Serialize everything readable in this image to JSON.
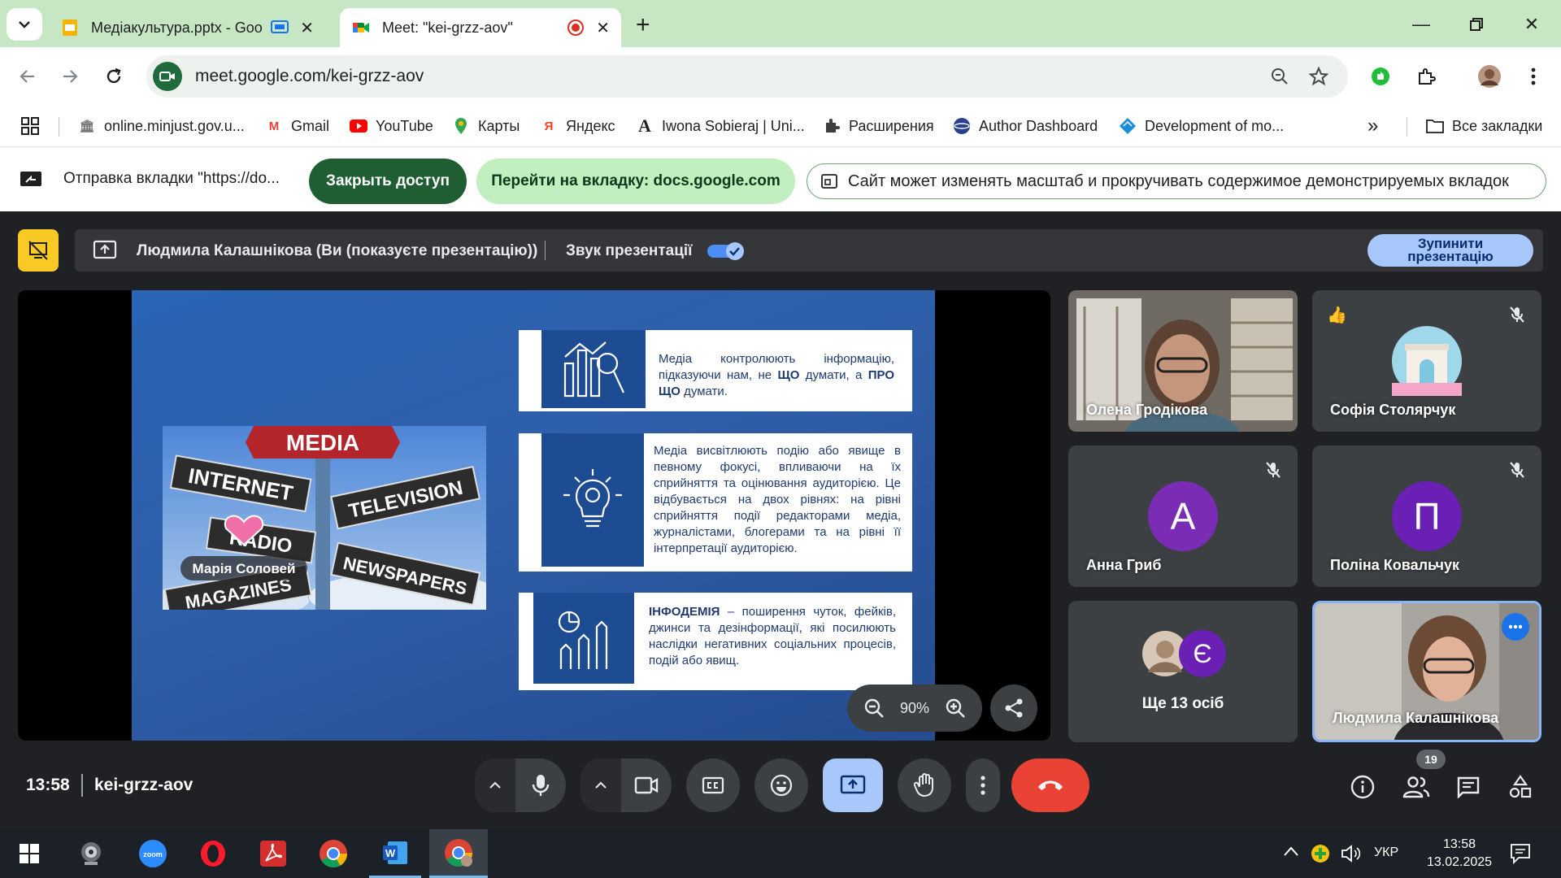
{
  "browser": {
    "tabs": [
      {
        "title": "Медіакультура.pptx - Goog",
        "active": false
      },
      {
        "title": "Meet: \"kei-grzz-aov\"",
        "active": true
      }
    ],
    "url": "meet.google.com/kei-grzz-aov",
    "bookmarks": [
      {
        "label": "online.minjust.gov.u...",
        "icon": "building-icon"
      },
      {
        "label": "Gmail",
        "icon": "gmail-icon"
      },
      {
        "label": "YouTube",
        "icon": "youtube-icon"
      },
      {
        "label": "Карты",
        "icon": "maps-pin-icon"
      },
      {
        "label": "Яндекс",
        "icon": "yandex-icon"
      },
      {
        "label": "Iwona Sobieraj | Uni...",
        "icon": "letter-a-icon"
      },
      {
        "label": "Расширения",
        "icon": "puzzle-icon"
      },
      {
        "label": "Author Dashboard",
        "icon": "globe-icon"
      },
      {
        "label": "Development of mo...",
        "icon": "diamond-icon"
      }
    ],
    "all_bookmarks_label": "Все закладки"
  },
  "share_bar": {
    "sharing_text": "Отправка вкладки \"https://do...",
    "stop_button": "Закрыть доступ",
    "switch_button": "Перейти на вкладку: docs.google.com",
    "zoom_notice": "Сайт может изменять масштаб и прокручивать содержимое демонстрируемых вкладок"
  },
  "meet": {
    "presenting_label": "Людмила Калашнікова (Ви (показуєте презентацію))",
    "audio_label": "Звук презентації",
    "audio_on": true,
    "stop_presenting": [
      "Зупинити",
      "презентацію"
    ],
    "zoom_level": "90%",
    "clock": "13:58",
    "meeting_code": "kei-grzz-aov",
    "people_count": "19"
  },
  "slide": {
    "photo_signs": [
      "MEDIA",
      "INTERNET",
      "TELEVISION",
      "RADIO",
      "NEWSPAPERS",
      "MAGAZINES"
    ],
    "photo_caption": "Марія Соловей",
    "cards": [
      {
        "parts": [
          {
            "t": "Медіа контролюють інформацію, підказуючи нам, не "
          },
          {
            "t": "ЩО",
            "b": true
          },
          {
            "t": " думати, а "
          },
          {
            "t": "ПРО ЩО",
            "b": true
          },
          {
            "t": " думати."
          }
        ]
      },
      {
        "parts": [
          {
            "t": "Медіа висвітлюють подію або явище в певному фокусі, впливаючи на їх сприйняття та оцінювання аудиторією. Це відбувається на двох рівнях: на рівні сприйняття події редакторами медіа, журналістами, блогерами та на рівні її інтерпретації аудиторією."
          }
        ]
      },
      {
        "parts": [
          {
            "t": "ІНФОДЕМІЯ",
            "b": true
          },
          {
            "t": " – поширення чуток, фейків, джинси та дезінформації, які посилюють наслідки негативних соціальних процесів, подій або явищ."
          }
        ]
      }
    ]
  },
  "participants": [
    {
      "name": "Олена Гродікова",
      "type": "video"
    },
    {
      "name": "Софія Столярчук",
      "type": "avatar-image",
      "muted": true,
      "reaction": "👍"
    },
    {
      "name": "Анна Гриб",
      "type": "letter",
      "letter": "А",
      "color": "#7b2cb5",
      "muted": true
    },
    {
      "name": "Поліна Ковальчук",
      "type": "letter",
      "letter": "П",
      "color": "#6a1fb5",
      "muted": true
    },
    {
      "name": "Ще 13 осіб",
      "type": "group",
      "letter": "Є"
    },
    {
      "name": "Людмила Калашнікова",
      "type": "video-self"
    }
  ],
  "taskbar": {
    "lang": "УКР",
    "time": "13:58",
    "date": "13.02.2025"
  }
}
